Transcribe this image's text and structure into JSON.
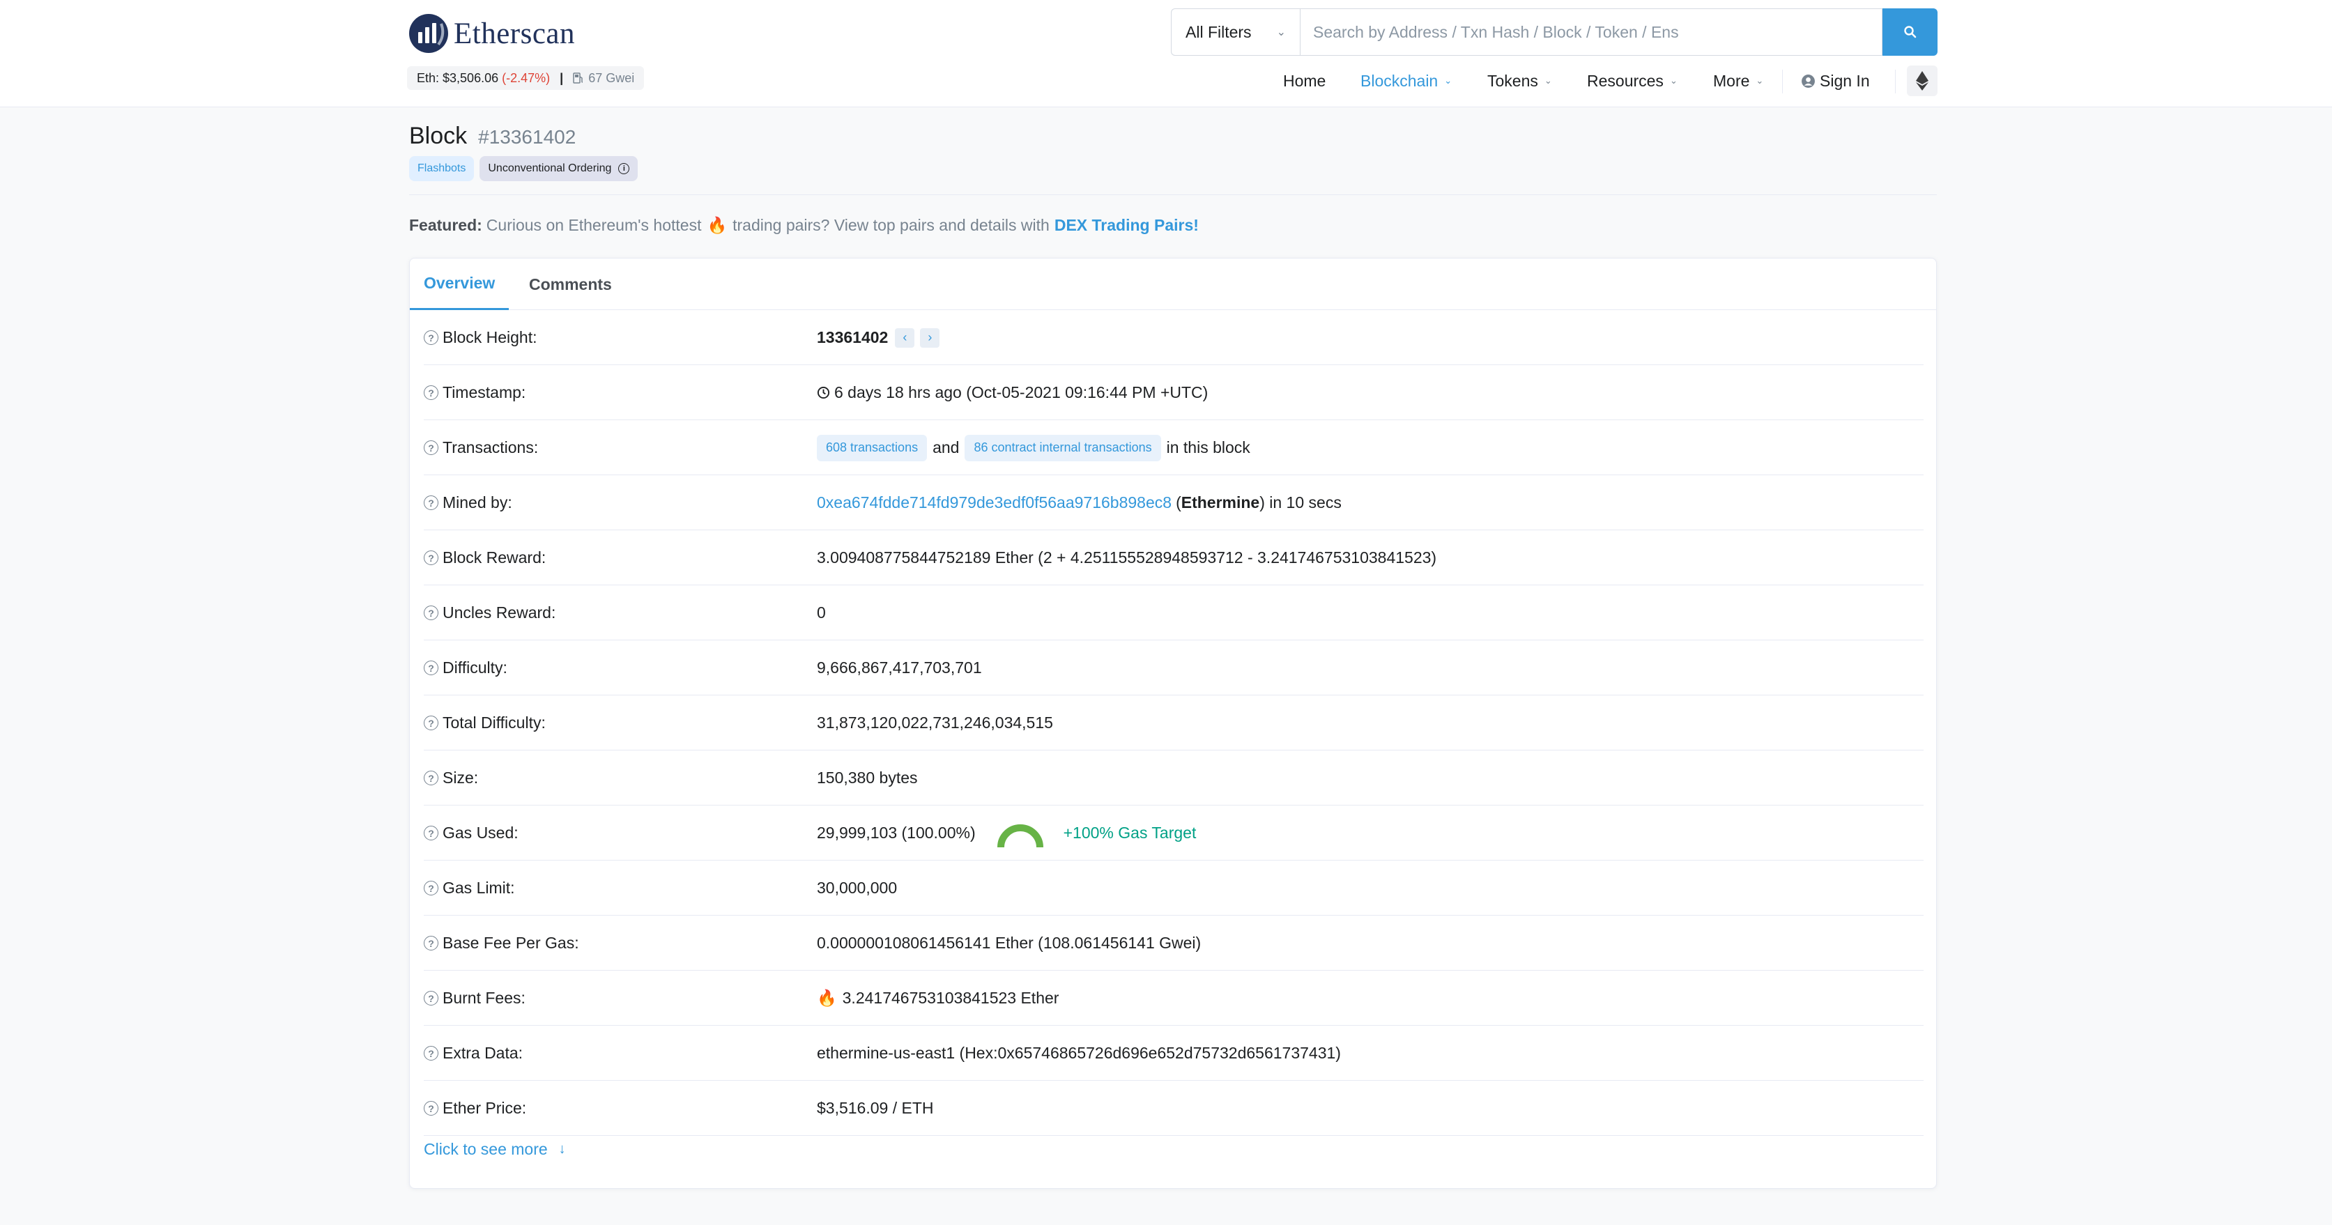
{
  "header": {
    "logo_text": "Etherscan",
    "eth_price_label": "Eth: $3,506.06",
    "eth_change": "(-2.47%)",
    "separator": "|",
    "gas_price": "67 Gwei",
    "filter_selected": "All Filters",
    "search_placeholder": "Search by Address / Txn Hash / Block / Token / Ens",
    "nav": {
      "home": "Home",
      "blockchain": "Blockchain",
      "tokens": "Tokens",
      "resources": "Resources",
      "more": "More",
      "sign_in": "Sign In"
    }
  },
  "page": {
    "title": "Block",
    "block_number": "#13361402",
    "badges": [
      "Flashbots",
      "Unconventional Ordering"
    ],
    "featured_label": "Featured:",
    "featured_text_1": "Curious on Ethereum's hottest",
    "featured_text_2": "trading pairs? View top pairs and details with",
    "featured_link": "DEX Trading Pairs!"
  },
  "tabs": [
    "Overview",
    "Comments"
  ],
  "overview": {
    "block_height": {
      "label": "Block Height:",
      "value": "13361402"
    },
    "timestamp": {
      "label": "Timestamp:",
      "value": "6 days 18 hrs ago (Oct-05-2021 09:16:44 PM +UTC)"
    },
    "transactions": {
      "label": "Transactions:",
      "txn_link": "608 transactions",
      "and": "and",
      "internal_link": "86 contract internal transactions",
      "suffix": "in this block"
    },
    "mined_by": {
      "label": "Mined by:",
      "address": "0xea674fdde714fd979de3edf0f56aa9716b898ec8",
      "open_paren": "(",
      "miner": "Ethermine",
      "suffix": ") in 10 secs"
    },
    "block_reward": {
      "label": "Block Reward:",
      "value": "3.009408775844752189 Ether (2 + 4.251155528948593712 - 3.241746753103841523)"
    },
    "uncles_reward": {
      "label": "Uncles Reward:",
      "value": "0"
    },
    "difficulty": {
      "label": "Difficulty:",
      "value": "9,666,867,417,703,701"
    },
    "total_difficulty": {
      "label": "Total Difficulty:",
      "value": "31,873,120,022,731,246,034,515"
    },
    "size": {
      "label": "Size:",
      "value": "150,380 bytes"
    },
    "gas_used": {
      "label": "Gas Used:",
      "value": "29,999,103 (100.00%)",
      "gauge_fraction": 1.0,
      "target": "+100% Gas Target"
    },
    "gas_limit": {
      "label": "Gas Limit:",
      "value": "30,000,000"
    },
    "base_fee": {
      "label": "Base Fee Per Gas:",
      "value": "0.000000108061456141 Ether (108.061456141 Gwei)"
    },
    "burnt_fees": {
      "label": "Burnt Fees:",
      "value": "3.241746753103841523 Ether"
    },
    "extra_data": {
      "label": "Extra Data:",
      "value": "ethermine-us-east1 (Hex:0x65746865726d696e652d75732d6561737431)"
    },
    "ether_price": {
      "label": "Ether Price:",
      "value": "$3,516.09 / ETH"
    }
  },
  "see_more": "Click to see more",
  "colors": {
    "brand": "#21325b",
    "accent": "#3498db",
    "negative": "#de4437",
    "positive": "#00a186",
    "gauge": "#67b346"
  },
  "icons": [
    "etherscan-logo-icon",
    "gas-pump-icon",
    "search-icon",
    "user-circle-icon",
    "ethereum-icon",
    "question-icon",
    "clock-icon",
    "fire-icon",
    "chevron-left-icon",
    "chevron-right-icon",
    "arrow-down-icon",
    "info-icon"
  ]
}
